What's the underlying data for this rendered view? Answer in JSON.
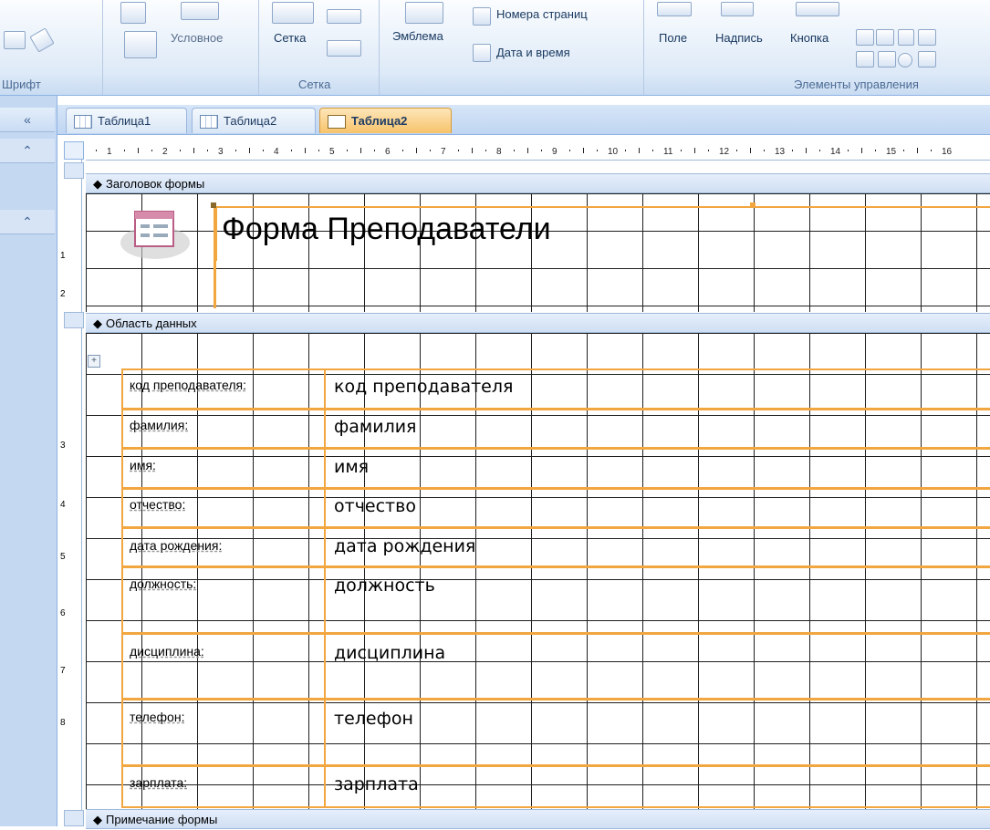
{
  "ribbon": {
    "conditional": "Условное",
    "grid_btn": "Сетка",
    "emblem": "Эмблема",
    "page_numbers": "Номера страниц",
    "date_time": "Дата и время",
    "field": "Поле",
    "caption": "Надпись",
    "button": "Кнопка",
    "groups": {
      "font": "Шрифт",
      "grid": "Сетка",
      "controls": "Элементы управления"
    }
  },
  "nav": {
    "collapse": "«",
    "up1": "⌃",
    "up2": "⌃"
  },
  "tabs": [
    {
      "label": "Таблица1"
    },
    {
      "label": "Таблица2"
    },
    {
      "label": "Таблица2"
    }
  ],
  "ruler": {
    "top": [
      "1",
      "2",
      "3",
      "4",
      "5",
      "6",
      "7",
      "8",
      "9",
      "10",
      "11",
      "12",
      "13",
      "14",
      "15",
      "16"
    ],
    "left": [
      "1",
      "2",
      "3",
      "4",
      "5",
      "6",
      "7",
      "8"
    ]
  },
  "sections": {
    "header": "Заголовок формы",
    "detail": "Область данных",
    "footer": "Примечание формы"
  },
  "form": {
    "title": "Форма Преподаватели",
    "fields": [
      {
        "label": "код преподавателя:",
        "value": "код преподавателя"
      },
      {
        "label": "фамилия:",
        "value": "фамилия"
      },
      {
        "label": "имя:",
        "value": "имя"
      },
      {
        "label": "отчество:",
        "value": "отчество"
      },
      {
        "label": "дата рождения:",
        "value": "дата рождения"
      },
      {
        "label": "должность:",
        "value": "должность"
      },
      {
        "label": "дисциплина:",
        "value": "дисциплина"
      },
      {
        "label": "телефон:",
        "value": "телефон"
      },
      {
        "label": "зарплата:",
        "value": "зарплата"
      }
    ]
  }
}
